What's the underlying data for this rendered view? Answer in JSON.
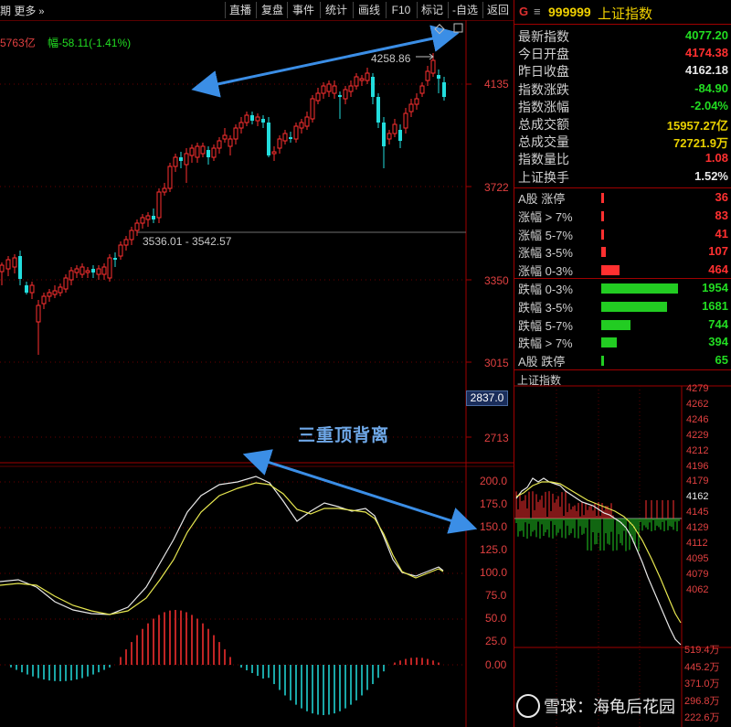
{
  "toolbar": {
    "left_label": "期",
    "more_label": "更多",
    "buttons": [
      "直播",
      "复盘",
      "事件",
      "统计",
      "画线",
      "F10",
      "标记",
      "-自选",
      "返回"
    ]
  },
  "info_line": {
    "amount": "5763亿",
    "change": "幅-58.11(-1.41%)"
  },
  "price_axis": [
    "4135",
    "3722",
    "3350",
    "3015",
    "2713"
  ],
  "price_box": "2837.0",
  "annotations": {
    "high": "4258.86",
    "range": "3536.01 - 3542.57",
    "divergence": "三重顶背离"
  },
  "macd_axis": [
    "200.0",
    "175.0",
    "150.0",
    "125.0",
    "100.0",
    "75.0",
    "50.0",
    "25.0",
    "0.00"
  ],
  "panel": {
    "flag": "G",
    "menu": "≡",
    "code": "999999",
    "name": "上证指数",
    "quotes": [
      {
        "label": "最新指数",
        "value": "4077.20",
        "color": "#22dd22"
      },
      {
        "label": "今日开盘",
        "value": "4174.38",
        "color": "#ff3030"
      },
      {
        "label": "昨日收盘",
        "value": "4162.18",
        "color": "#e8e8e8"
      },
      {
        "label": "指数涨跌",
        "value": "-84.90",
        "color": "#22dd22"
      },
      {
        "label": "指数涨幅",
        "value": "-2.04%",
        "color": "#22dd22"
      },
      {
        "label": "总成交额",
        "value": "15957.27亿",
        "color": "#e8d000"
      },
      {
        "label": "总成交量",
        "value": "72721.9万",
        "color": "#e8d000"
      },
      {
        "label": "指数量比",
        "value": "1.08",
        "color": "#ff3030"
      },
      {
        "label": "上证换手",
        "value": "1.52%",
        "color": "#e8e8e8"
      }
    ],
    "ups": [
      {
        "label": "A股 涨停",
        "value": "36",
        "fill": 0.02
      },
      {
        "label": "涨幅 > 7%",
        "value": "83",
        "fill": 0.04
      },
      {
        "label": "涨幅 5-7%",
        "value": "41",
        "fill": 0.02
      },
      {
        "label": "涨幅 3-5%",
        "value": "107",
        "fill": 0.055
      },
      {
        "label": "涨幅 0-3%",
        "value": "464",
        "fill": 0.24
      }
    ],
    "downs": [
      {
        "label": "跌幅 0-3%",
        "value": "1954",
        "fill": 1.0
      },
      {
        "label": "跌幅 3-5%",
        "value": "1681",
        "fill": 0.86
      },
      {
        "label": "跌幅 5-7%",
        "value": "744",
        "fill": 0.38
      },
      {
        "label": "跌幅 > 7%",
        "value": "394",
        "fill": 0.2
      },
      {
        "label": "A股 跌停",
        "value": "65",
        "fill": 0.035
      }
    ],
    "intraday_title": "上证指数",
    "intraday_axis": [
      "4279",
      "4262",
      "4246",
      "4229",
      "4212",
      "4196",
      "4179",
      "4162",
      "4145",
      "4129",
      "4112",
      "4095",
      "4079",
      "4062"
    ],
    "volume_axis": [
      "519.4万",
      "445.2万",
      "371.0万",
      "296.8万",
      "222.6万"
    ]
  },
  "watermark": "雪球：海龟后花园",
  "colors": {
    "up": "#ff3030",
    "down": "#22dddd",
    "axis": "#a00000",
    "arrow": "#3b8ee6"
  }
}
